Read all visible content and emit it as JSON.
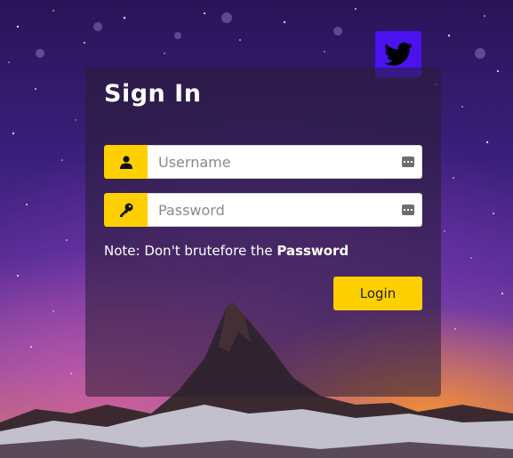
{
  "form": {
    "title": "Sign In",
    "username_placeholder": "Username",
    "password_placeholder": "Password",
    "note_prefix": "Note: Don't brutefore the ",
    "note_emphasis": "Password",
    "login_label": "Login"
  },
  "icons": {
    "social": "twitter-icon",
    "username": "user-icon",
    "password": "key-icon",
    "autofill": "autofill-icon"
  },
  "colors": {
    "accent": "#ffd000",
    "twitter": "#4b12f0",
    "card": "rgba(40,30,50,0.55)"
  }
}
